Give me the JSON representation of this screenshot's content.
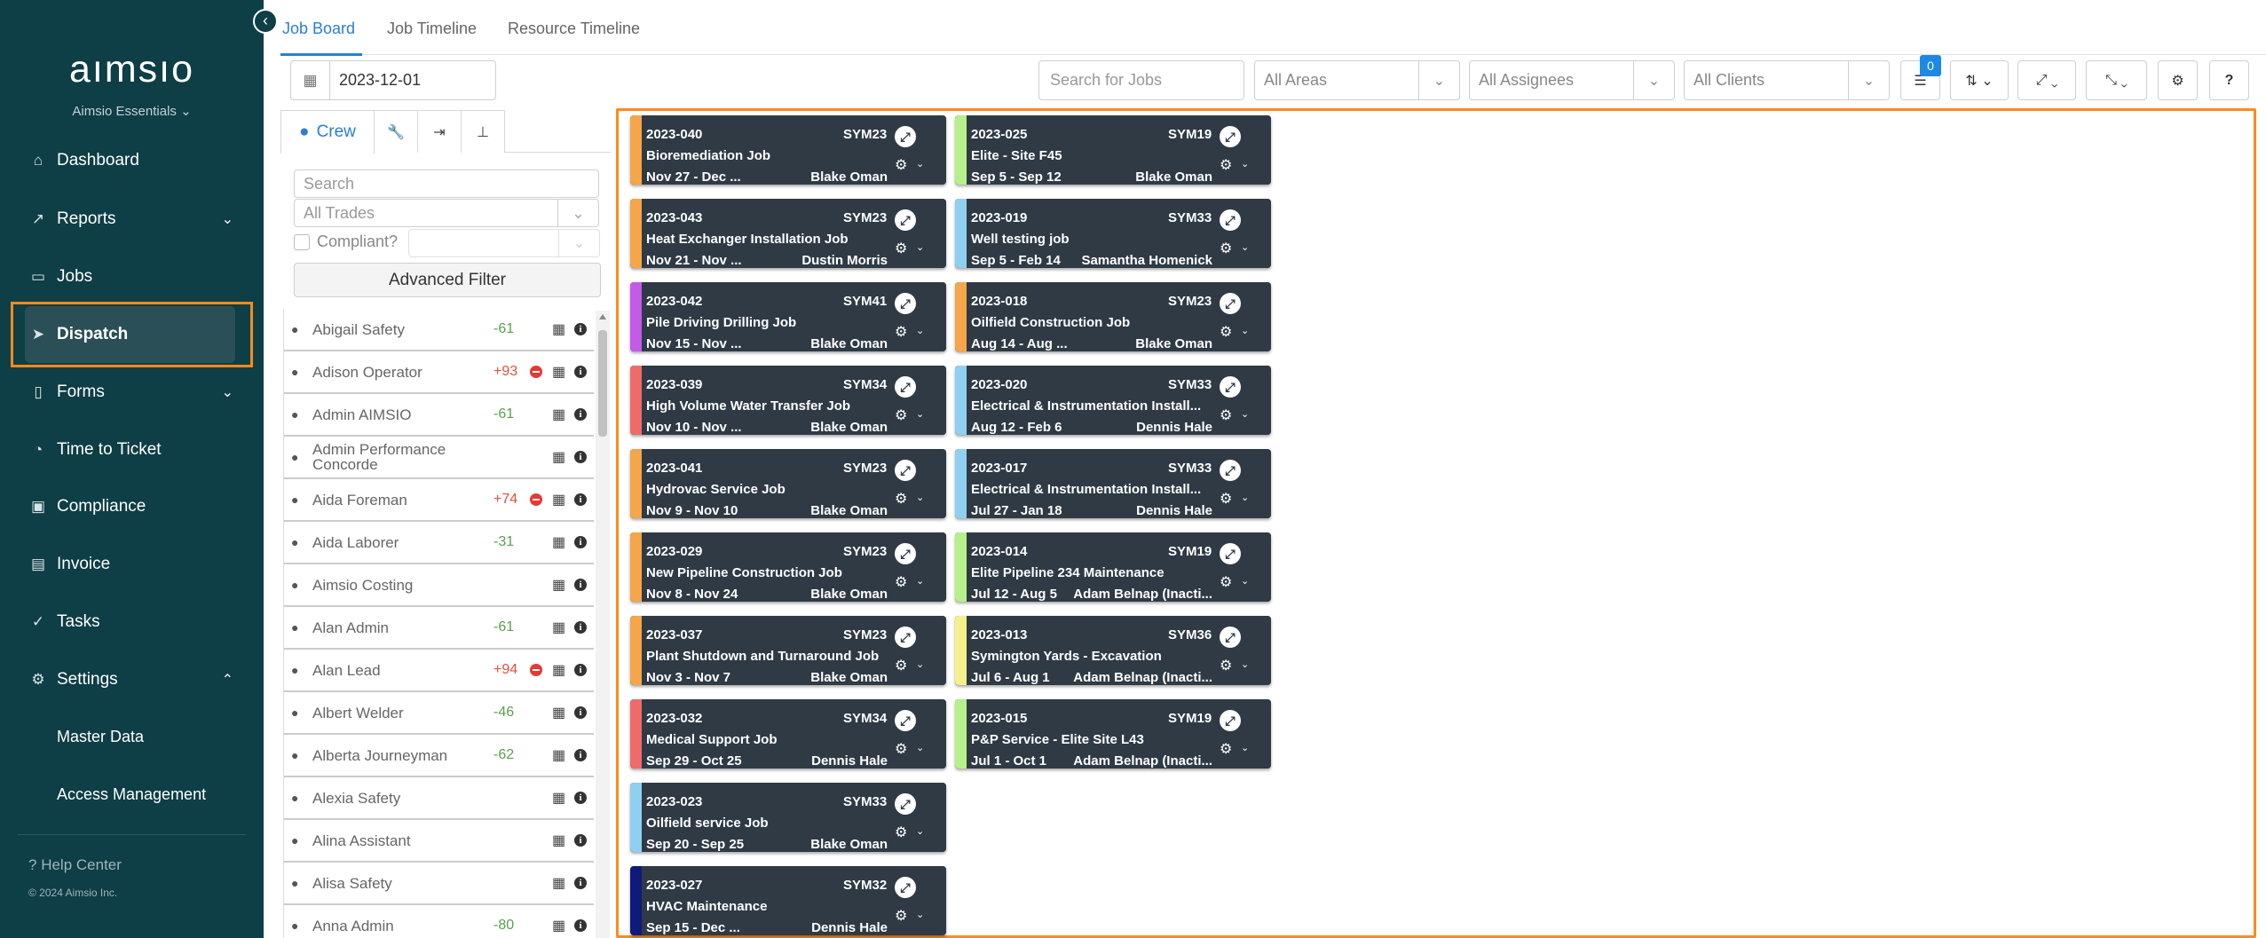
{
  "sidebar": {
    "logo": "aımsıo",
    "subtitle": "Aimsio Essentials ⌄",
    "items": [
      {
        "label": "Dashboard",
        "icon": "home-icon"
      },
      {
        "label": "Reports",
        "icon": "chart-icon"
      },
      {
        "label": "Jobs",
        "icon": "folder-icon"
      },
      {
        "label": "Dispatch",
        "icon": "send-icon"
      },
      {
        "label": "Forms",
        "icon": "document-icon"
      },
      {
        "label": "Time to Ticket",
        "icon": "clock-icon"
      },
      {
        "label": "Compliance",
        "icon": "certificate-icon"
      },
      {
        "label": "Invoice",
        "icon": "invoice-icon"
      },
      {
        "label": "Tasks",
        "icon": "check-circle-icon"
      },
      {
        "label": "Settings",
        "icon": "gear-icon"
      }
    ],
    "sub_items": [
      "Master Data",
      "Access Management"
    ],
    "help": "Help Center",
    "copyright": "© 2024 Aimsio Inc."
  },
  "tabs": [
    "Job Board",
    "Job Timeline",
    "Resource Timeline"
  ],
  "toolbar": {
    "date": "2023-12-01",
    "search_placeholder": "Search for Jobs",
    "areas": "All Areas",
    "assignees": "All Assignees",
    "clients": "All Clients",
    "badge_count": "0"
  },
  "crew_panel": {
    "crew_tab": "Crew",
    "search_placeholder": "Search",
    "trades": "All Trades",
    "compliant_label": "Compliant?",
    "advanced_filter": "Advanced Filter",
    "members": [
      {
        "name": "Abigail Safety",
        "hours": "-61",
        "flag": false
      },
      {
        "name": "Adison Operator",
        "hours": "+93",
        "flag": true
      },
      {
        "name": "Admin AIMSIO",
        "hours": "-61",
        "flag": false
      },
      {
        "name": "Admin Performance Concorde",
        "hours": "",
        "flag": false
      },
      {
        "name": "Aida Foreman",
        "hours": "+74",
        "flag": true
      },
      {
        "name": "Aida Laborer",
        "hours": "-31",
        "flag": false
      },
      {
        "name": "Aimsio Costing",
        "hours": "",
        "flag": false
      },
      {
        "name": "Alan Admin",
        "hours": "-61",
        "flag": false
      },
      {
        "name": "Alan Lead",
        "hours": "+94",
        "flag": true
      },
      {
        "name": "Albert Welder",
        "hours": "-46",
        "flag": false
      },
      {
        "name": "Alberta Journeyman",
        "hours": "-62",
        "flag": false
      },
      {
        "name": "Alexia Safety",
        "hours": "",
        "flag": false
      },
      {
        "name": "Alina Assistant",
        "hours": "",
        "flag": false
      },
      {
        "name": "Alisa Safety",
        "hours": "",
        "flag": false
      },
      {
        "name": "Anna Admin",
        "hours": "-80",
        "flag": false
      }
    ]
  },
  "jobs": [
    {
      "id": "2023-040",
      "sym": "SYM23",
      "title": "Bioremediation Job",
      "dates": "Nov 27 - Dec ...",
      "person": "Blake Oman",
      "color": "#f5a54a"
    },
    {
      "id": "2023-043",
      "sym": "SYM23",
      "title": "Heat Exchanger Installation Job",
      "dates": "Nov 21 - Nov ...",
      "person": "Dustin Morris",
      "color": "#f5a54a"
    },
    {
      "id": "2023-042",
      "sym": "SYM41",
      "title": "Pile Driving Drilling Job",
      "dates": "Nov 15 - Nov ...",
      "person": "Blake Oman",
      "color": "#c35be8"
    },
    {
      "id": "2023-039",
      "sym": "SYM34",
      "title": "High Volume Water Transfer Job",
      "dates": "Nov 10 - Nov ...",
      "person": "Blake Oman",
      "color": "#ef6b6b"
    },
    {
      "id": "2023-041",
      "sym": "SYM23",
      "title": "Hydrovac Service Job",
      "dates": "Nov 9 - Nov 10",
      "person": "Blake Oman",
      "color": "#f5a54a"
    },
    {
      "id": "2023-029",
      "sym": "SYM23",
      "title": "New Pipeline Construction Job",
      "dates": "Nov 8 - Nov 24",
      "person": "Blake Oman",
      "color": "#f5a54a"
    },
    {
      "id": "2023-037",
      "sym": "SYM23",
      "title": "Plant Shutdown and Turnaround Job",
      "dates": "Nov 3 - Nov 7",
      "person": "Blake Oman",
      "color": "#f5a54a"
    },
    {
      "id": "2023-032",
      "sym": "SYM34",
      "title": "Medical Support Job",
      "dates": "Sep 29 - Oct 25",
      "person": "Dennis Hale",
      "color": "#ef6b6b"
    },
    {
      "id": "2023-023",
      "sym": "SYM33",
      "title": "Oilfield service Job",
      "dates": "Sep 20 - Sep 25",
      "person": "Blake Oman",
      "color": "#8fd0f0"
    },
    {
      "id": "2023-027",
      "sym": "SYM32",
      "title": "HVAC Maintenance",
      "dates": "Sep 15 - Dec ...",
      "person": "Dennis Hale",
      "color": "#101a7a"
    },
    {
      "id": "2023-025",
      "sym": "SYM19",
      "title": "Elite - Site F45",
      "dates": "Sep 5 - Sep 12",
      "person": "Blake Oman",
      "color": "#b7f08a"
    },
    {
      "id": "2023-019",
      "sym": "SYM33",
      "title": "Well testing job",
      "dates": "Sep 5 - Feb 14",
      "person": "Samantha Homenick",
      "color": "#8fd0f0"
    },
    {
      "id": "2023-018",
      "sym": "SYM23",
      "title": "Oilfield Construction Job",
      "dates": "Aug 14 - Aug ...",
      "person": "Blake Oman",
      "color": "#f5a54a"
    },
    {
      "id": "2023-020",
      "sym": "SYM33",
      "title": "Electrical & Instrumentation Install...",
      "dates": "Aug 12 - Feb 6",
      "person": "Dennis Hale",
      "color": "#8fd0f0"
    },
    {
      "id": "2023-017",
      "sym": "SYM33",
      "title": "Electrical & Instrumentation Install...",
      "dates": "Jul 27 - Jan 18",
      "person": "Dennis Hale",
      "color": "#8fd0f0"
    },
    {
      "id": "2023-014",
      "sym": "SYM19",
      "title": "Elite Pipeline 234 Maintenance",
      "dates": "Jul 12 - Aug 5",
      "person": "Adam Belnap (Inacti...",
      "color": "#b7f08a"
    },
    {
      "id": "2023-013",
      "sym": "SYM36",
      "title": "Symington Yards - Excavation",
      "dates": "Jul 6 - Aug 1",
      "person": "Adam Belnap (Inacti...",
      "color": "#f6f08a"
    },
    {
      "id": "2023-015",
      "sym": "SYM19",
      "title": "P&P Service - Elite Site L43",
      "dates": "Jul 1 - Oct 1",
      "person": "Adam Belnap (Inacti...",
      "color": "#b7f08a"
    }
  ]
}
